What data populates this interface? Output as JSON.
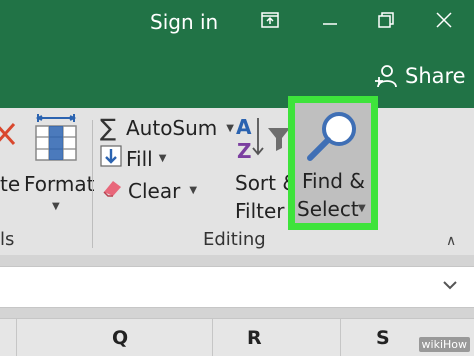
{
  "titlebar": {
    "title": "Sign in",
    "share_label": "Share",
    "icons": [
      "ribbon-display-options-icon",
      "minimize-icon",
      "restore-icon",
      "close-icon",
      "add-person-icon"
    ]
  },
  "ribbon": {
    "cells_group": {
      "delete_fragment": "te",
      "format_label": "Format",
      "group_label_fragment": "ls"
    },
    "editing_group": {
      "autosum_label": "AutoSum",
      "fill_label": "Fill",
      "clear_label": "Clear",
      "sort_filter_line1": "Sort &",
      "sort_filter_line2": "Filter",
      "find_select_line1": "Find &",
      "find_select_line2": "Select",
      "group_label": "Editing"
    },
    "highlight_color": "#3ee33b",
    "accent": "#217346"
  },
  "formula_bar": {
    "expand_icon": "chevron-down-icon"
  },
  "columns": [
    "Q",
    "R",
    "S"
  ],
  "watermark": "wikiHow"
}
